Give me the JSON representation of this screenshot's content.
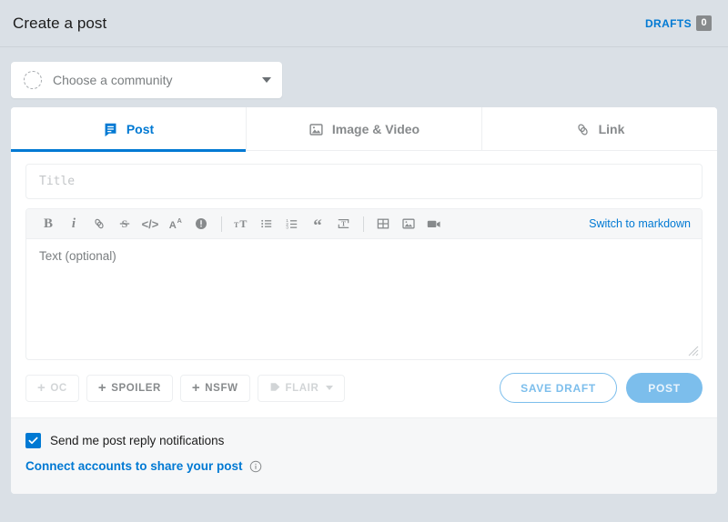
{
  "header": {
    "title": "Create a post",
    "drafts_label": "DRAFTS",
    "drafts_count": "0"
  },
  "community": {
    "placeholder": "Choose a community",
    "avatar_icon": "dashed-circle-avatar",
    "caret_icon": "chevron-down-icon"
  },
  "tabs": [
    {
      "label": "Post",
      "icon": "post-document-icon",
      "active": true
    },
    {
      "label": "Image & Video",
      "icon": "image-icon",
      "active": false
    },
    {
      "label": "Link",
      "icon": "link-chain-icon",
      "active": false
    }
  ],
  "form": {
    "title_placeholder": "Title",
    "title_value": "",
    "body_placeholder": "Text (optional)",
    "body_value": ""
  },
  "toolbar": {
    "markdown_link": "Switch to markdown",
    "buttons": [
      {
        "name": "bold",
        "glyph": "B"
      },
      {
        "name": "italic",
        "glyph": "i"
      },
      {
        "name": "link",
        "glyph": "link"
      },
      {
        "name": "strikethrough",
        "glyph": "S"
      },
      {
        "name": "inline-code",
        "glyph": "</>"
      },
      {
        "name": "superscript",
        "glyph": "Aᴬ"
      },
      {
        "name": "spoiler",
        "glyph": "!"
      },
      {
        "name": "heading",
        "glyph": "T"
      },
      {
        "name": "bulleted-list",
        "glyph": "list"
      },
      {
        "name": "numbered-list",
        "glyph": "123"
      },
      {
        "name": "quote-block",
        "glyph": "“"
      },
      {
        "name": "code-block",
        "glyph": "T-block"
      },
      {
        "name": "table",
        "glyph": "grid"
      },
      {
        "name": "image-upload",
        "glyph": "image"
      },
      {
        "name": "video-upload",
        "glyph": "video"
      }
    ]
  },
  "tag_buttons": [
    {
      "label": "OC",
      "icon": "plus-icon",
      "disabled": true
    },
    {
      "label": "SPOILER",
      "icon": "plus-icon",
      "disabled": false
    },
    {
      "label": "NSFW",
      "icon": "plus-icon",
      "disabled": false
    },
    {
      "label": "FLAIR",
      "icon": "tag-icon",
      "disabled": true,
      "caret": true
    }
  ],
  "actions": {
    "save_draft_label": "SAVE DRAFT",
    "post_label": "POST"
  },
  "footer": {
    "notify_label": "Send me post reply notifications",
    "notify_checked": true,
    "connect_label": "Connect accounts to share your post",
    "info_icon": "info-circle-icon"
  },
  "colors": {
    "page_background": "#DAE0E6",
    "accent_blue": "#0079D3",
    "muted_blue": "#7CBEEC",
    "text_muted": "#878A8C",
    "border": "#EDEFF1",
    "footer_background": "#F6F7F8"
  }
}
